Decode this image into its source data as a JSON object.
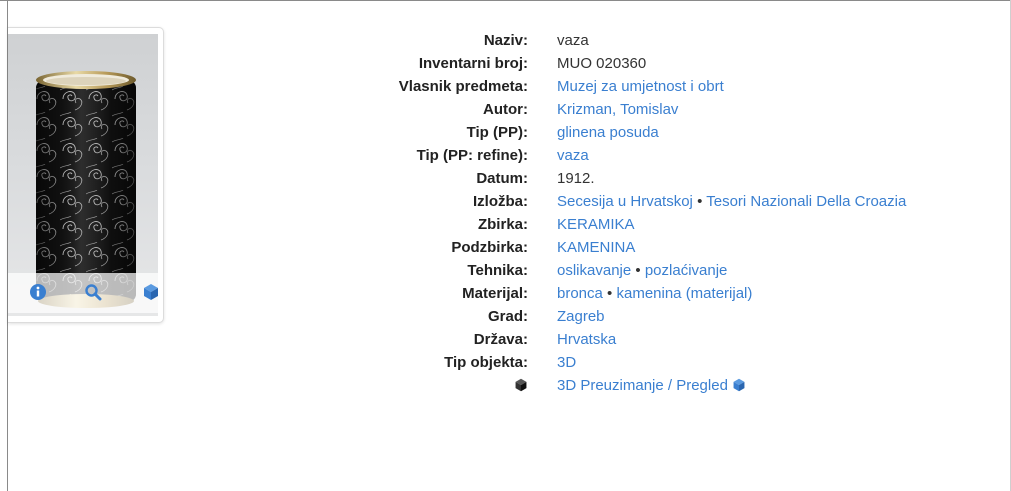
{
  "details": [
    {
      "label": "Naziv:",
      "values": [
        {
          "text": "vaza",
          "link": false
        }
      ]
    },
    {
      "label": "Inventarni broj:",
      "values": [
        {
          "text": "MUO 020360",
          "link": false
        }
      ]
    },
    {
      "label": "Vlasnik predmeta:",
      "values": [
        {
          "text": "Muzej za umjetnost i obrt",
          "link": true
        }
      ]
    },
    {
      "label": "Autor:",
      "values": [
        {
          "text": "Krizman, Tomislav",
          "link": true
        }
      ]
    },
    {
      "label": "Tip (PP):",
      "values": [
        {
          "text": "glinena posuda",
          "link": true
        }
      ]
    },
    {
      "label": "Tip (PP: refine):",
      "values": [
        {
          "text": "vaza",
          "link": true
        }
      ]
    },
    {
      "label": "Datum:",
      "values": [
        {
          "text": "1912.",
          "link": false
        }
      ]
    },
    {
      "label": "Izložba:",
      "values": [
        {
          "text": "Secesija u Hrvatskoj",
          "link": true
        },
        {
          "text": "Tesori Nazionali Della Croazia",
          "link": true
        }
      ]
    },
    {
      "label": "Zbirka:",
      "values": [
        {
          "text": "KERAMIKA",
          "link": true
        }
      ]
    },
    {
      "label": "Podzbirka:",
      "values": [
        {
          "text": "KAMENINA",
          "link": true
        }
      ]
    },
    {
      "label": "Tehnika:",
      "values": [
        {
          "text": "oslikavanje",
          "link": true
        },
        {
          "text": "pozlaćivanje",
          "link": true
        }
      ]
    },
    {
      "label": "Materijal:",
      "values": [
        {
          "text": "bronca",
          "link": true
        },
        {
          "text": "kamenina (materijal)",
          "link": true
        }
      ]
    },
    {
      "label": "Grad:",
      "values": [
        {
          "text": "Zagreb",
          "link": true
        }
      ]
    },
    {
      "label": "Država:",
      "values": [
        {
          "text": "Hrvatska",
          "link": true
        }
      ]
    },
    {
      "label": "Tip objekta:",
      "values": [
        {
          "text": "3D",
          "link": true
        }
      ]
    },
    {
      "label": "",
      "label_icon": "cube-icon",
      "values": [
        {
          "text": "3D Preuzimanje / Pregled",
          "link": true,
          "icon": "cube-icon"
        }
      ]
    }
  ],
  "separator": "•",
  "card": {
    "icons": [
      "info-icon",
      "zoom-icon",
      "cube-icon"
    ]
  },
  "colors": {
    "link": "#3a7fd0",
    "label": "#222222",
    "text": "#333333"
  }
}
